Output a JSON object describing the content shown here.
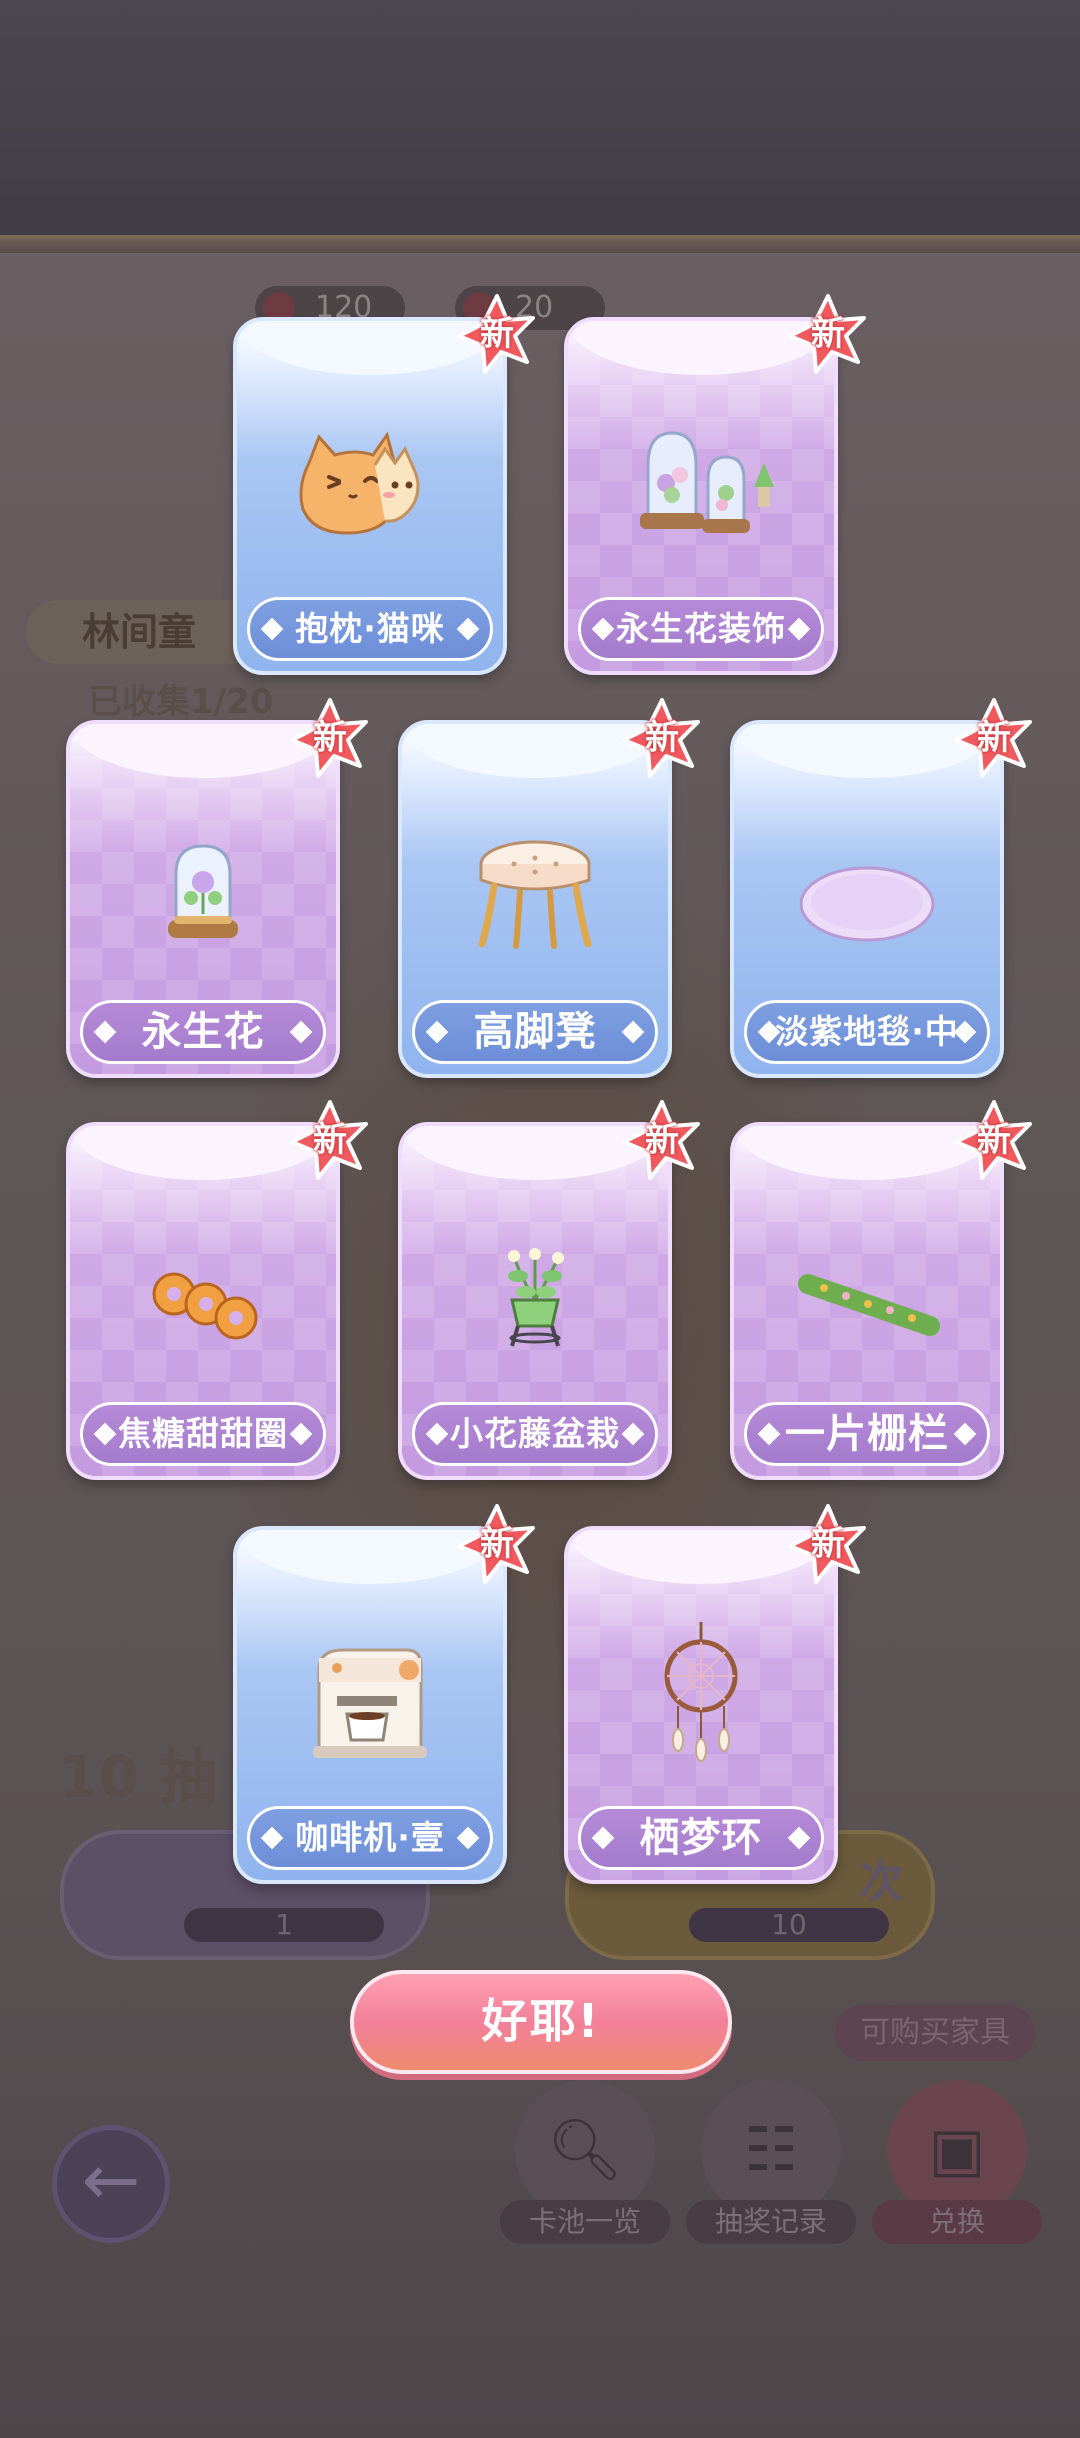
{
  "background": {
    "resource_1": "120",
    "resource_2": "20",
    "collection_title": "林间童",
    "collected": "已收集1/20",
    "ten_draw_label": "10 抽",
    "left_draw_count": "1",
    "right_draw_count": "10",
    "right_draw_label": "次",
    "buy_tag": "可购买家具",
    "bottom_buttons": [
      {
        "label": "卡池一览",
        "icon": "magnifier-icon"
      },
      {
        "label": "抽奖记录",
        "icon": "record-search-icon"
      },
      {
        "label": "兑换",
        "icon": "shopping-bag-icon"
      }
    ]
  },
  "badge_text": "新",
  "cards": [
    {
      "name": "抱枕·猫咪",
      "rarity": "blue",
      "icon": "cat-pillow-icon"
    },
    {
      "name": "永生花装饰",
      "rarity": "purple",
      "icon": "glass-dome-flowers-icon"
    },
    {
      "name": "永生花",
      "rarity": "purple",
      "icon": "glass-dome-flower-icon"
    },
    {
      "name": "高脚凳",
      "rarity": "blue",
      "icon": "stool-icon"
    },
    {
      "name": "淡紫地毯·中",
      "rarity": "blue",
      "icon": "rug-icon"
    },
    {
      "name": "焦糖甜甜圈",
      "rarity": "purple",
      "icon": "donuts-icon"
    },
    {
      "name": "小花藤盆栽",
      "rarity": "purple",
      "icon": "potted-plant-icon"
    },
    {
      "name": "一片栅栏",
      "rarity": "purple",
      "icon": "hedge-fence-icon"
    },
    {
      "name": "咖啡机·壹",
      "rarity": "blue",
      "icon": "coffee-machine-icon"
    },
    {
      "name": "栖梦环",
      "rarity": "purple",
      "icon": "dreamcatcher-icon"
    }
  ],
  "confirm_button": "好耶!",
  "colors": {
    "blue_card": "#90b4ee",
    "purple_card": "#c49ae0",
    "badge_red": "#f05a5f",
    "confirm_pink": "#f2809a"
  }
}
